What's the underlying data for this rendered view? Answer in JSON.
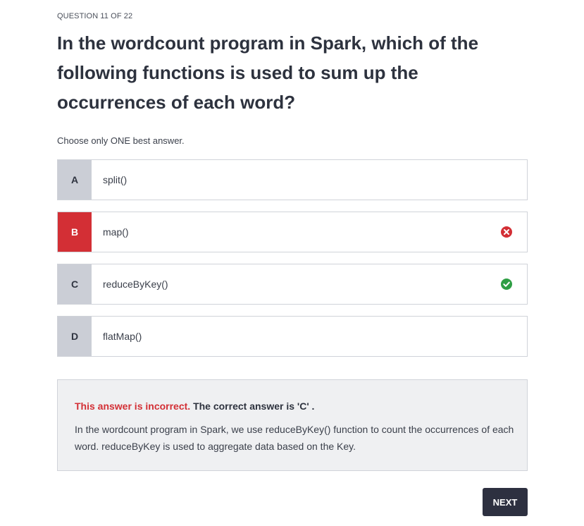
{
  "question": {
    "counter": "QUESTION 11 OF 22",
    "title": "In the wordcount program in Spark, which of the following functions is used to sum up the occurrences of each word?",
    "instruction": "Choose only ONE best answer."
  },
  "options": [
    {
      "letter": "A",
      "text": "split()",
      "status": "none"
    },
    {
      "letter": "B",
      "text": "map()",
      "status": "wrong",
      "icon": "x-circle-icon"
    },
    {
      "letter": "C",
      "text": "reduceByKey()",
      "status": "correct",
      "icon": "check-circle-icon"
    },
    {
      "letter": "D",
      "text": "flatMap()",
      "status": "none"
    }
  ],
  "feedback": {
    "incorrect_label": "This answer is incorrect.",
    "correct_answer_text": "The correct answer is 'C' .",
    "explanation": "In the wordcount program in Spark, we use reduceByKey() function to count the occurrences of each word. reduceByKey is used to aggregate data based on the Key."
  },
  "actions": {
    "next_label": "NEXT"
  },
  "colors": {
    "wrong": "#d32f35",
    "correct": "#2e9e44",
    "letter_bg": "#cbced6",
    "next_bg": "#2d3040"
  }
}
